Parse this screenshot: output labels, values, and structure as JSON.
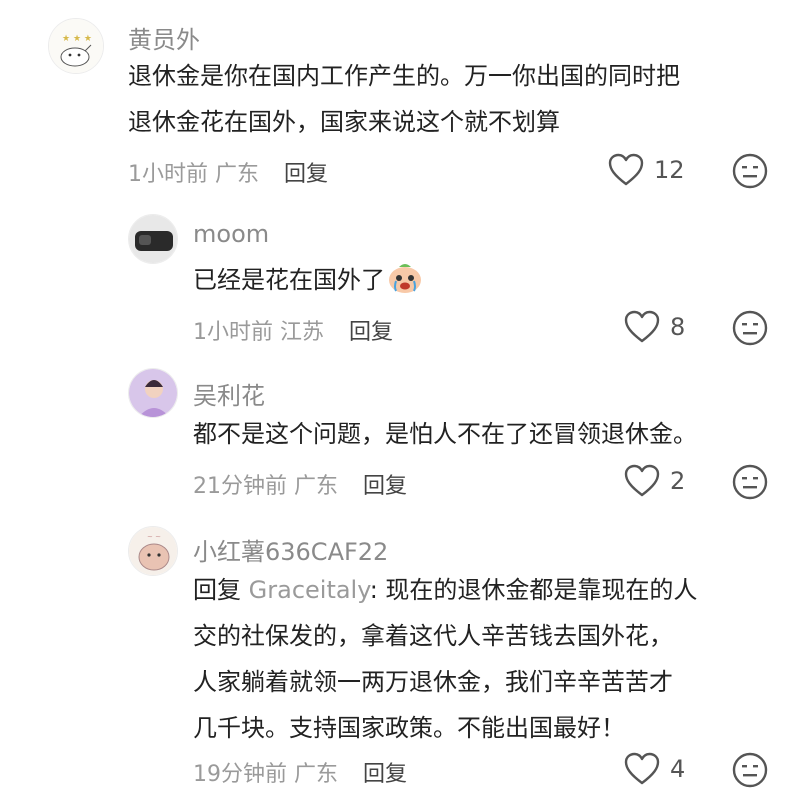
{
  "comments": [
    {
      "username": "黄员外",
      "lines": [
        "退休金是你在国内工作产生的。万一你出国的同时把",
        "退休金花在国外，国家来说这个就不划算"
      ],
      "time": "1小时前",
      "location": "广东",
      "reply_label": "回复",
      "likes": "12"
    },
    {
      "username": "moom",
      "lines": [
        "已经是花在国外了"
      ],
      "time": "1小时前",
      "location": "江苏",
      "reply_label": "回复",
      "likes": "8"
    },
    {
      "username": "吴利花",
      "lines": [
        "都不是这个问题，是怕人不在了还冒领退休金。"
      ],
      "time": "21分钟前",
      "location": "广东",
      "reply_label": "回复",
      "likes": "2"
    },
    {
      "username": "小红薯636CAF22",
      "reply_prefix": "回复 ",
      "reply_target": "Graceitaly",
      "lines": [
        ": 现在的退休金都是靠现在的人",
        "交的社保发的，拿着这代人辛苦钱去国外花，",
        "人家躺着就领一两万退休金，我们辛辛苦苦才",
        "几千块。支持国家政策。不能出国最好！"
      ],
      "time": "19分钟前",
      "location": "广东",
      "reply_label": "回复",
      "likes": "4"
    }
  ],
  "icons": {
    "like": "heart-outline-icon",
    "reaction": "neutral-face-icon",
    "inline_emoji": "crying-face-emoji"
  },
  "colors": {
    "username": "#8a8a8a",
    "meta": "#9a9a9a",
    "text": "#222222"
  }
}
